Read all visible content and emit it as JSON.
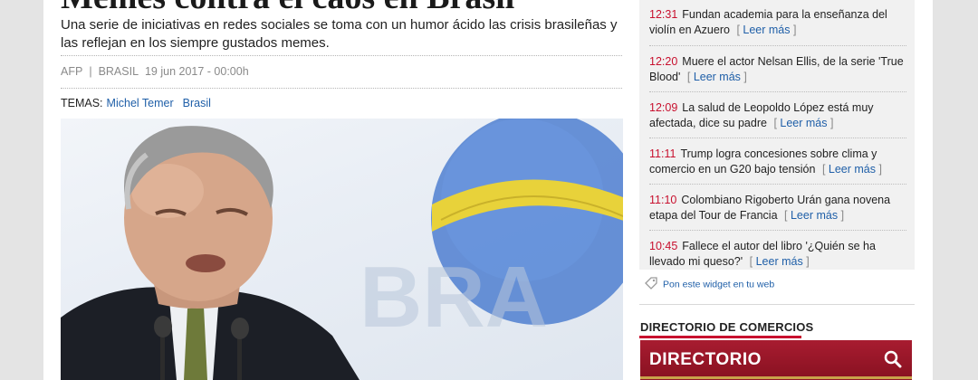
{
  "article": {
    "headline": "Memes contra el caos en Brasil",
    "summary": "Una serie de iniciativas en redes sociales se toma con un humor ácido las crisis brasileñas y las reflejan en los siempre gustados memes.",
    "source": "AFP",
    "section": "BRASIL",
    "date": "19 jun 2017 - 00:00h",
    "topics_label": "TEMAS:",
    "topics": [
      "Michel Temer",
      "Brasil"
    ]
  },
  "ticker": {
    "more_label": "Leer más",
    "items": [
      {
        "time": "12:31",
        "text": "Fundan academia para la enseñanza del violín en Azuero"
      },
      {
        "time": "12:20",
        "text": "Muere el actor Nelsan Ellis, de la serie 'True Blood'"
      },
      {
        "time": "12:09",
        "text": "La salud de Leopoldo López está muy afectada, dice su padre"
      },
      {
        "time": "11:11",
        "text": "Trump logra concesiones sobre clima y comercio en un G20 bajo tensión"
      },
      {
        "time": "11:10",
        "text": "Colombiano Rigoberto Urán gana novena etapa del Tour de Francia"
      },
      {
        "time": "10:45",
        "text": "Fallece el autor del libro '¿Quién se ha llevado mi queso?'"
      }
    ]
  },
  "widget_link": "Pon este widget en tu web",
  "directory": {
    "heading": "DIRECTORIO DE COMERCIOS",
    "box_label": "DIRECTORIO"
  },
  "icons": {
    "widget": "tag-icon",
    "search": "search-icon"
  },
  "colors": {
    "accent": "#c8102e",
    "link": "#1f5fa8",
    "directory_bg": "#9a1a2c"
  }
}
